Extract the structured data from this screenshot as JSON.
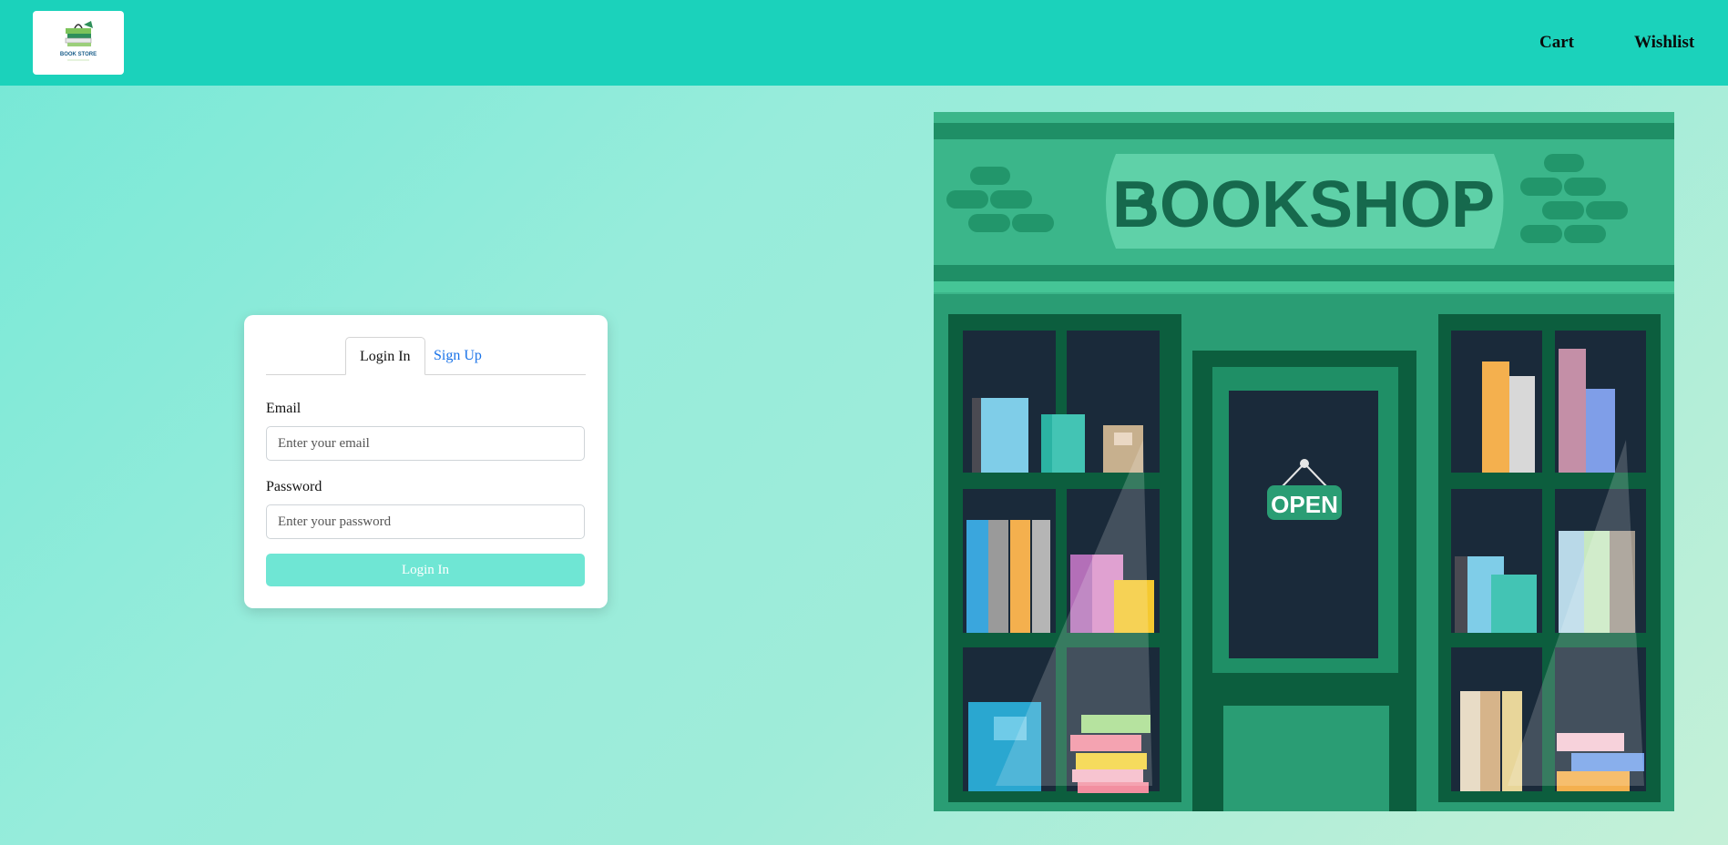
{
  "header": {
    "logo_alt": "BOOK STORE",
    "nav": {
      "cart": "Cart",
      "wishlist": "Wishlist"
    }
  },
  "auth": {
    "tabs": {
      "login": "Login In",
      "signup": "Sign Up"
    },
    "email_label": "Email",
    "email_placeholder": "Enter your email",
    "password_label": "Password",
    "password_placeholder": "Enter your password",
    "submit_label": "Login In"
  },
  "illustration": {
    "sign_text": "BOOKSHOP",
    "door_sign_text": "OPEN"
  },
  "colors": {
    "header": "#1bd2bb",
    "accent_button": "#6fe6d4",
    "link": "#1a73e8",
    "shop_green": "#2a9d74"
  }
}
